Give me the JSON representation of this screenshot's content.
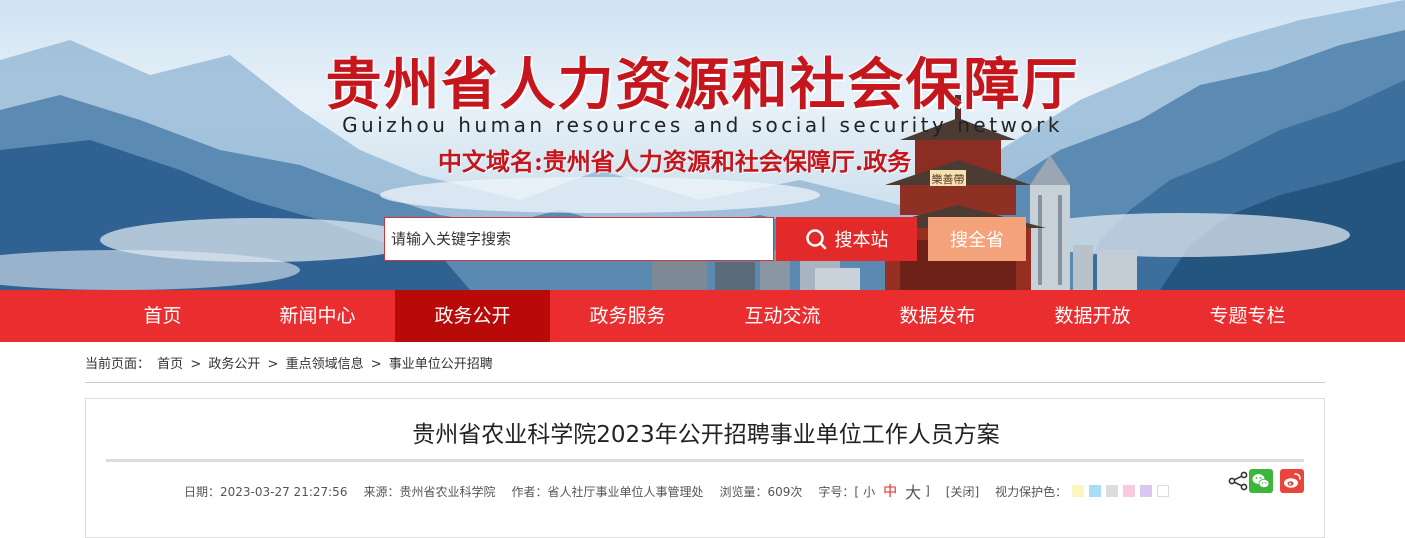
{
  "header": {
    "title": "贵州省人力资源和社会保障厅",
    "subtitle": "Guizhou human resources and social security network",
    "domain_label": "中文域名:贵州省人力资源和社会保障厅.政务",
    "tower_sign": "樂善帶"
  },
  "search": {
    "placeholder": "请输入关键字搜索",
    "search_site_label": "搜本站",
    "search_province_label": "搜全省"
  },
  "nav": {
    "items": [
      {
        "label": "首页"
      },
      {
        "label": "新闻中心"
      },
      {
        "label": "政务公开"
      },
      {
        "label": "政务服务"
      },
      {
        "label": "互动交流"
      },
      {
        "label": "数据发布"
      },
      {
        "label": "数据开放"
      },
      {
        "label": "专题专栏"
      }
    ],
    "active_index": 2
  },
  "breadcrumb": {
    "prefix": "当前页面：",
    "items": [
      "首页",
      "政务公开",
      "重点领域信息",
      "事业单位公开招聘"
    ],
    "separator": ">"
  },
  "article": {
    "title": "贵州省农业科学院2023年公开招聘事业单位工作人员方案",
    "meta": {
      "date": "日期：2023-03-27 21:27:56",
      "source": "来源：贵州省农业科学院",
      "author": "作者：省人社厅事业单位人事管理处",
      "views": "浏览量：609次",
      "font_size_label": "字号：[",
      "font_small": "小",
      "font_medium": "中",
      "font_large": "大",
      "font_close": "]",
      "close_label": "[关闭]",
      "eye_protect_label": "视力保护色：",
      "swatch_colors": [
        "#fbf5c2",
        "#a8def5",
        "#dddddd",
        "#f7cbde",
        "#dcc7f0",
        "#ffffff"
      ]
    },
    "share_icons": [
      "share-icon",
      "wechat-icon",
      "weibo-icon"
    ]
  },
  "colors": {
    "brand_red": "#ea2d2e",
    "nav_active": "#b90a0a",
    "title_red": "#c4161c",
    "search_province_bg": "#f3a27a",
    "wechat_green": "#3bb53a",
    "weibo_red": "#e8463b"
  }
}
